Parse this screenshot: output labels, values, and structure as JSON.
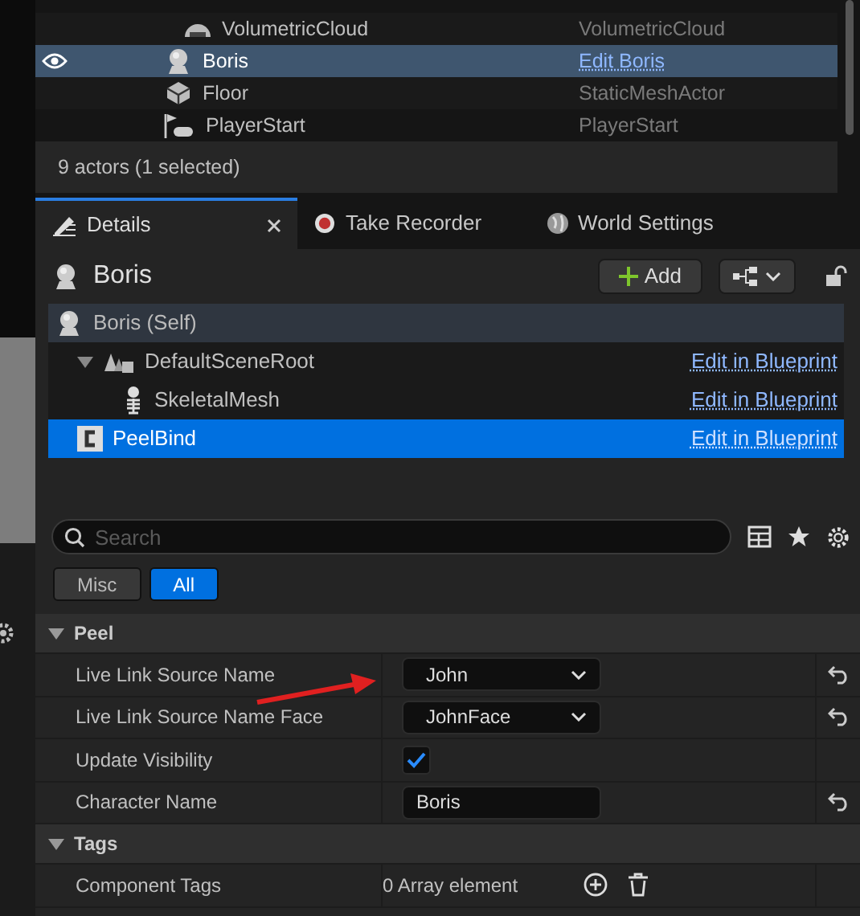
{
  "outliner": {
    "rows": [
      {
        "name": "VolumetricCloud",
        "type": "VolumetricCloud",
        "kind": "cloud",
        "selected": false,
        "edit_link": false
      },
      {
        "name": "Boris",
        "type": "Edit Boris",
        "kind": "pawn",
        "selected": true,
        "edit_link": true
      },
      {
        "name": "Floor",
        "type": "StaticMeshActor",
        "kind": "mesh",
        "selected": false,
        "edit_link": false
      },
      {
        "name": "PlayerStart",
        "type": "PlayerStart",
        "kind": "start",
        "selected": false,
        "edit_link": false
      }
    ],
    "status": "9 actors (1 selected)"
  },
  "tabs": [
    {
      "label": "Details",
      "selected": true
    },
    {
      "label": "Take Recorder",
      "selected": false
    },
    {
      "label": "World Settings",
      "selected": false
    }
  ],
  "actor": {
    "name": "Boris",
    "add_button": "Add"
  },
  "components": [
    {
      "name": "Boris (Self)",
      "kind": "self",
      "selected": false,
      "children": [
        {
          "name": "DefaultSceneRoot",
          "kind": "scene",
          "selected": false,
          "expanded": true,
          "link": "Edit in Blueprint",
          "children": [
            {
              "name": "SkeletalMesh",
              "kind": "skeleton",
              "selected": false,
              "link": "Edit in Blueprint"
            }
          ]
        },
        {
          "name": "PeelBind",
          "kind": "class",
          "selected": true,
          "link": "Edit in Blueprint"
        }
      ]
    }
  ],
  "search": {
    "placeholder": "Search"
  },
  "filters": [
    {
      "label": "Misc",
      "selected": false
    },
    {
      "label": "All",
      "selected": true
    }
  ],
  "categories": [
    {
      "name": "Peel",
      "expanded": true,
      "properties": [
        {
          "label": "Live Link Source Name",
          "kind": "dropdown",
          "value": "John",
          "resettable": true
        },
        {
          "label": "Live Link Source Name Face",
          "kind": "dropdown",
          "value": "JohnFace",
          "resettable": true
        },
        {
          "label": "Update Visibility",
          "kind": "checkbox",
          "checked": true,
          "resettable": false
        },
        {
          "label": "Character Name",
          "kind": "text",
          "value": "Boris",
          "resettable": true
        }
      ]
    },
    {
      "name": "Tags",
      "expanded": true,
      "properties": [
        {
          "label": "Component Tags",
          "kind": "array",
          "value": "0 Array element",
          "resettable": false
        }
      ]
    }
  ]
}
